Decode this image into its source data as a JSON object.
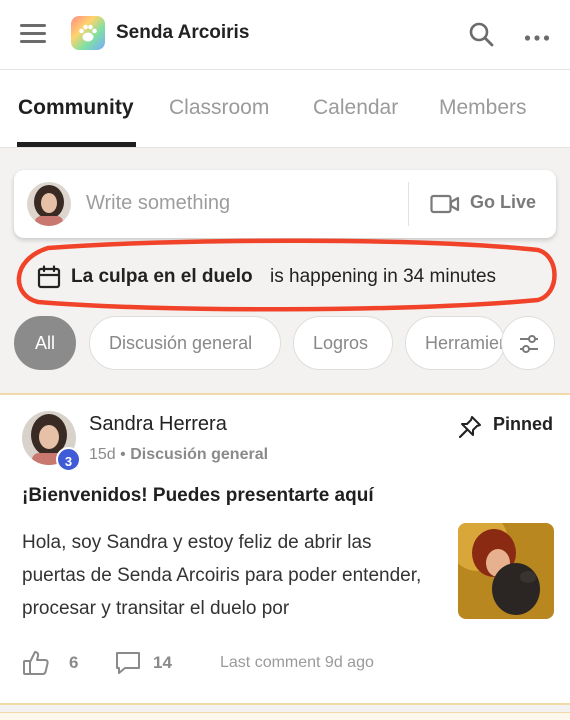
{
  "header": {
    "menu_icon": "hamburger-menu-icon",
    "logo_icon": "paw-logo-icon",
    "title": "Senda Arcoiris",
    "search_icon": "search-icon",
    "more_icon": "more-horizontal-icon"
  },
  "tabs": [
    {
      "label": "Community",
      "active": true
    },
    {
      "label": "Classroom",
      "active": false
    },
    {
      "label": "Calendar",
      "active": false
    },
    {
      "label": "Members",
      "active": false
    }
  ],
  "composer": {
    "placeholder": "Write something",
    "go_live_label": "Go Live",
    "go_live_icon": "video-camera-icon"
  },
  "event_banner": {
    "icon": "calendar-icon",
    "event_name": "La culpa en el duelo",
    "status_text": "is happening in 34 minutes",
    "highlight_color": "#f0432a"
  },
  "filters": {
    "items": [
      {
        "label": "All",
        "active": true
      },
      {
        "label": "Discusión general",
        "active": false
      },
      {
        "label": "Logros",
        "active": false
      },
      {
        "label": "Herramientas",
        "active": false
      }
    ],
    "settings_icon": "sliders-icon"
  },
  "post": {
    "author": "Sandra Herrera",
    "level": "3",
    "age": "15d",
    "separator": "•",
    "category": "Discusión general",
    "pinned_label": "Pinned",
    "title": "¡Bienvenidos! Puedes presentarte aquí",
    "body": "Hola, soy Sandra y estoy feliz de abrir las puertas de Senda Arcoiris para poder entender, procesar y transitar el duelo por",
    "likes": "6",
    "comments": "14",
    "last_comment": "Last comment 9d ago"
  },
  "colors": {
    "accent_level_badge": "#3f5bd6",
    "active_chip": "#8b8b8b",
    "post_border": "#f3d9a8"
  }
}
